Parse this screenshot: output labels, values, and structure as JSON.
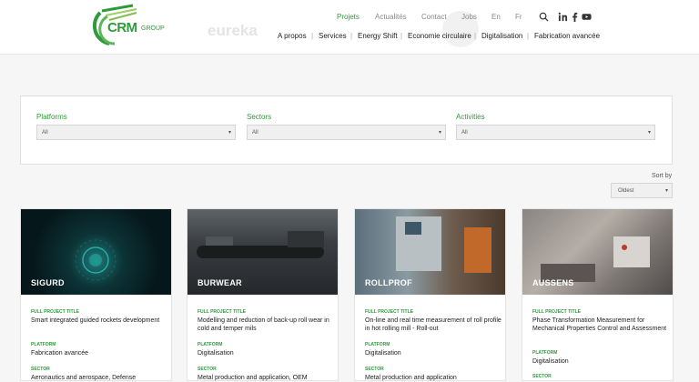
{
  "header": {
    "logo_text": "CRM",
    "logo_group": "GROUP",
    "watermark": "eureka",
    "top_nav": [
      "Projets",
      "Actualités",
      "Contact",
      "Jobs",
      "En",
      "Fr"
    ],
    "main_nav": [
      "A propos",
      "Services",
      "Energy Shift",
      "Economie circulaire",
      "Digitalisation",
      "Fabrication avancée"
    ],
    "icons": [
      "search-icon",
      "linkedin-icon",
      "facebook-icon",
      "youtube-icon"
    ]
  },
  "filters": {
    "platforms": {
      "label": "Platforms",
      "value": "All"
    },
    "sectors": {
      "label": "Sectors",
      "value": "All"
    },
    "activities": {
      "label": "Activities",
      "value": "All"
    }
  },
  "sort": {
    "label": "Sort by",
    "value": "Oldest"
  },
  "cards": [
    {
      "name": "SIGURD",
      "title_label": "FULL PROJECT TITLE",
      "title": "Smart integrated guided rockets development",
      "platform_label": "PLATFORM",
      "platform": "Fabrication avancée",
      "sector_label": "SECTOR",
      "sector": "Aeronautics and aerospace, Defense"
    },
    {
      "name": "BURWEAR",
      "title_label": "FULL PROJECT TITLE",
      "title": "Modelling and reduction of back-up roll wear in cold and temper mils",
      "platform_label": "PLATFORM",
      "platform": "Digitalisation",
      "sector_label": "SECTOR",
      "sector": "Metal production and application, OEM"
    },
    {
      "name": "ROLLPROF",
      "title_label": "FULL PROJECT TITLE",
      "title": "On-line and real time measurement of roll profile in hot rolling mill - Roll-out",
      "platform_label": "PLATFORM",
      "platform": "Digitalisation",
      "sector_label": "SECTOR",
      "sector": "Metal production and application"
    },
    {
      "name": "AUSSENS",
      "title_label": "FULL PROJECT TITLE",
      "title": "Phase Transformation Measurement for Mechanical Properties Control and Assessment",
      "platform_label": "PLATFORM",
      "platform": "Digitalisation",
      "sector_label": "SECTOR",
      "sector": ""
    }
  ]
}
